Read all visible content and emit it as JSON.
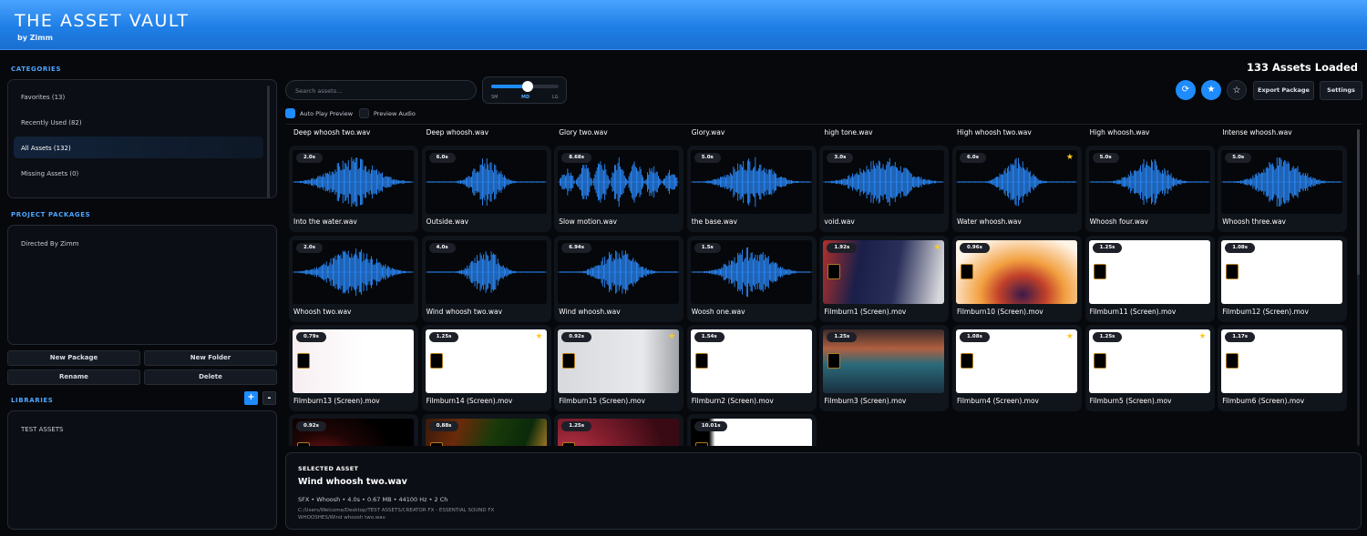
{
  "app": {
    "title": "THE ASSET VAULT",
    "subtitle": "by Zimm"
  },
  "sidebar": {
    "categories_title": "CATEGORIES",
    "categories": [
      {
        "label": "Favorites (13)",
        "active": false
      },
      {
        "label": "Recently Used (82)",
        "active": false
      },
      {
        "label": "All Assets (132)",
        "active": true
      },
      {
        "label": "Missing Assets (0)",
        "active": false
      }
    ],
    "packages_title": "PROJECT PACKAGES",
    "packages": [
      "Directed By Zimm"
    ],
    "buttons": {
      "new_package": "New Package",
      "new_folder": "New Folder",
      "rename": "Rename",
      "delete": "Delete"
    },
    "libraries_title": "LIBRARIES",
    "add_library": "+",
    "remove_library": "-",
    "libraries": [
      "TEST ASSETS"
    ]
  },
  "topbar": {
    "assets_loaded": "133 Assets Loaded",
    "search_placeholder": "Search assets...",
    "size": {
      "labels": [
        "SM",
        "MD",
        "LG"
      ],
      "selected": "MD",
      "level": 0.5
    },
    "auto_play": {
      "label": "Auto Play Preview",
      "checked": true
    },
    "preview_audio": {
      "label": "Preview Audio",
      "checked": false
    },
    "icons": {
      "refresh": "refresh-icon",
      "favorites": "star-filled-icon",
      "favorite_toggle": "star-outline-icon"
    },
    "export_label": "Export Package",
    "settings_label": "Settings"
  },
  "grid": {
    "top_row_names": [
      "Deep whoosh two.wav",
      "Deep whoosh.wav",
      "Glory two.wav",
      "Glory.wav",
      "high tone.wav",
      "High whoosh two.wav",
      "High whoosh.wav",
      "Intense whoosh.wav"
    ],
    "rows": [
      [
        {
          "name": "Into the water.wav",
          "duration": "2.0s",
          "type": "audio",
          "star": false
        },
        {
          "name": "Outside.wav",
          "duration": "6.0s",
          "type": "audio",
          "star": false
        },
        {
          "name": "Slow motion.wav",
          "duration": "8.68s",
          "type": "audio",
          "star": false
        },
        {
          "name": "the base.wav",
          "duration": "5.0s",
          "type": "audio",
          "star": false
        },
        {
          "name": "void.wav",
          "duration": "3.0s",
          "type": "audio",
          "star": false
        },
        {
          "name": "Water whoosh.wav",
          "duration": "6.0s",
          "type": "audio",
          "star": true
        },
        {
          "name": "Whoosh four.wav",
          "duration": "5.0s",
          "type": "audio",
          "star": false
        },
        {
          "name": "Whoosh three.wav",
          "duration": "5.0s",
          "type": "audio",
          "star": false
        }
      ],
      [
        {
          "name": "Whoosh two.wav",
          "duration": "2.0s",
          "type": "audio",
          "star": false
        },
        {
          "name": "Wind whoosh two.wav",
          "duration": "4.0s",
          "type": "audio",
          "star": false
        },
        {
          "name": "Wind whoosh.wav",
          "duration": "6.94s",
          "type": "audio",
          "star": false
        },
        {
          "name": "Woosh one.wav",
          "duration": "1.5s",
          "type": "audio",
          "star": false
        },
        {
          "name": "Filmburn1 (Screen).mov",
          "duration": "1.92s",
          "type": "video",
          "star": true,
          "bg": "linear-gradient(100deg,#b2302a 0%,#1a1f4a 30%,#2a2f5a 60%,#d7d8dc 95%)"
        },
        {
          "name": "Filmburn10 (Screen).mov",
          "duration": "0.96s",
          "type": "video",
          "star": false,
          "bg": "radial-gradient(ellipse at 55% 85%,#3a1a4a 0%,#c2402a 25%,#f2a040 45%,#fff4e8 80%)"
        },
        {
          "name": "Filmburn11 (Screen).mov",
          "duration": "1.25s",
          "type": "video",
          "star": false,
          "bg": "#ffffff"
        },
        {
          "name": "Filmburn12 (Screen).mov",
          "duration": "1.08s",
          "type": "video",
          "star": false,
          "bg": "#ffffff"
        }
      ],
      [
        {
          "name": "Filmburn13 (Screen).mov",
          "duration": "0.79s",
          "type": "video",
          "star": false,
          "bg": "linear-gradient(90deg,#f6eef0,#fff 60%)"
        },
        {
          "name": "Filmburn14 (Screen).mov",
          "duration": "1.25s",
          "type": "video",
          "star": true,
          "bg": "#ffffff"
        },
        {
          "name": "Filmburn15 (Screen).mov",
          "duration": "0.92s",
          "type": "video",
          "star": true,
          "bg": "linear-gradient(90deg,#d8d9dc,#e8e9ec 70%,#a0a3a8)"
        },
        {
          "name": "Filmburn2 (Screen).mov",
          "duration": "1.54s",
          "type": "video",
          "star": false,
          "bg": "#ffffff"
        },
        {
          "name": "Filmburn3 (Screen).mov",
          "duration": "1.25s",
          "type": "video",
          "star": false,
          "bg": "linear-gradient(180deg,#3a2a2a 0%,#b06040 30%,#2a6a7a 55%,#1a3040 100%)"
        },
        {
          "name": "Filmburn4 (Screen).mov",
          "duration": "1.08s",
          "type": "video",
          "star": true,
          "bg": "#ffffff"
        },
        {
          "name": "Filmburn5 (Screen).mov",
          "duration": "1.25s",
          "type": "video",
          "star": true,
          "bg": "#ffffff"
        },
        {
          "name": "Filmburn6 (Screen).mov",
          "duration": "1.17s",
          "type": "video",
          "star": false,
          "bg": "#ffffff"
        }
      ],
      [
        {
          "name": "",
          "duration": "0.92s",
          "type": "video",
          "star": false,
          "bg": "radial-gradient(circle at 25% 90%,#c02020 0%,#200505 40%,#000 70%)"
        },
        {
          "name": "",
          "duration": "0.88s",
          "type": "video",
          "star": false,
          "bg": "linear-gradient(110deg,#3a1a0a 0%,#6a2a0a 25%,#1a3a0a 50%,#0a2a0a 75%,#f0a030 100%)"
        },
        {
          "name": "",
          "duration": "1.25s",
          "type": "video",
          "star": false,
          "bg": "radial-gradient(circle at 10% 80%,#d04050 0%,#8a2030 35%,#3a0a14 80%)"
        },
        {
          "name": "",
          "duration": "10.01s",
          "type": "video",
          "star": false,
          "bg": "linear-gradient(90deg,#000 0%,#000 15%,#fff 20%)"
        }
      ]
    ]
  },
  "details": {
    "label": "SELECTED ASSET",
    "title": "Wind whoosh two.wav",
    "meta": "SFX • Whoosh • 4.0s • 0.67 MB • 44100 Hz • 2 Ch",
    "path": "C:/Users/Welcome/Desktop/TEST ASSETS/CREATOR FX - ESSENTIAL SOUND FX WHOOSHES/Wind whoosh two.wav"
  },
  "colors": {
    "accent": "#1e8bff",
    "star": "#ffc928",
    "wave": "#2b8cff"
  }
}
